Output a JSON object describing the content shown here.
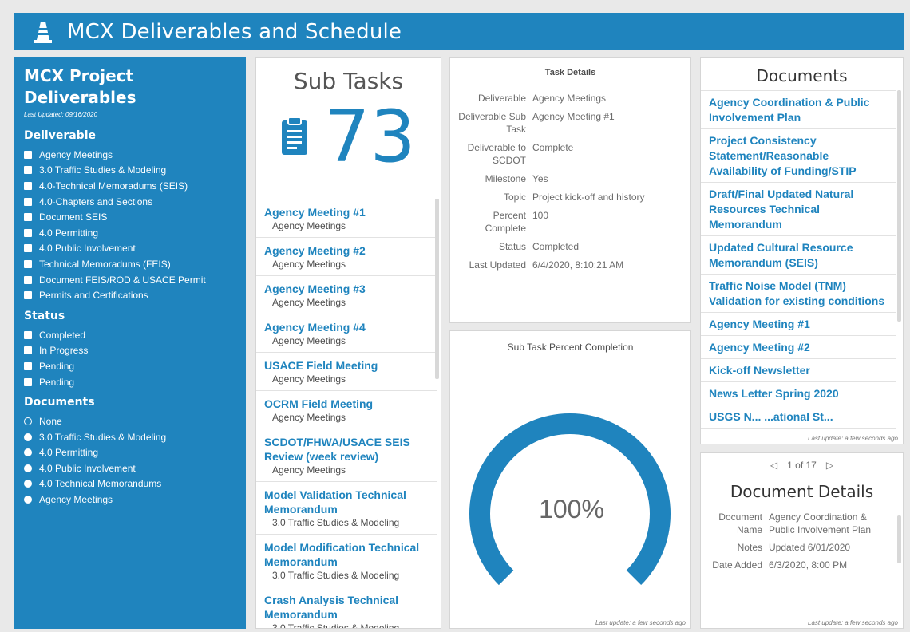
{
  "header": {
    "title": "MCX Deliverables and Schedule"
  },
  "sidebar": {
    "title": "MCX Project Deliverables",
    "last_updated": "Last Updated: 09/16/2020",
    "deliverable_heading": "Deliverable",
    "deliverables": [
      "Agency Meetings",
      "3.0 Traffic Studies & Modeling",
      "4.0-Technical Memoradums (SEIS)",
      "4.0-Chapters and Sections",
      "Document SEIS",
      "4.0 Permitting",
      "4.0 Public Involvement",
      "Technical Memoradums (FEIS)",
      "Document FEIS/ROD & USACE Permit",
      "Permits and Certifications"
    ],
    "status_heading": "Status",
    "statuses": [
      "Completed",
      "In Progress",
      "Pending",
      "Pending"
    ],
    "documents_heading": "Documents",
    "documents": [
      "None",
      "3.0 Traffic Studies & Modeling",
      "4.0 Permitting",
      "4.0 Public Involvement",
      "4.0 Technical Memorandums",
      "Agency Meetings"
    ]
  },
  "subtasks": {
    "title": "Sub Tasks",
    "count": "73",
    "icon": "clipboard-icon",
    "items": [
      {
        "name": "Agency Meeting #1",
        "category": "Agency Meetings"
      },
      {
        "name": "Agency Meeting #2",
        "category": "Agency Meetings"
      },
      {
        "name": "Agency Meeting #3",
        "category": "Agency Meetings"
      },
      {
        "name": "Agency Meeting #4",
        "category": "Agency Meetings"
      },
      {
        "name": "USACE Field Meeting",
        "category": "Agency Meetings"
      },
      {
        "name": "OCRM Field Meeting",
        "category": "Agency Meetings"
      },
      {
        "name": "SCDOT/FHWA/USACE SEIS Review (week review)",
        "category": "Agency Meetings"
      },
      {
        "name": "Model Validation Technical Memorandum",
        "category": "3.0 Traffic Studies & Modeling"
      },
      {
        "name": "Model Modification Technical Memorandum",
        "category": "3.0 Traffic Studies & Modeling"
      },
      {
        "name": "Crash Analysis Technical Memorandum",
        "category": "3.0 Traffic Studies & Modeling"
      }
    ]
  },
  "task_details": {
    "title": "Task Details",
    "rows": [
      {
        "label": "Deliverable",
        "value": "Agency Meetings"
      },
      {
        "label": "Deliverable Sub Task",
        "value": "Agency Meeting #1"
      },
      {
        "label": "Deliverable to SCDOT",
        "value": "Complete"
      },
      {
        "label": "Milestone",
        "value": "Yes"
      },
      {
        "label": "Topic",
        "value": "Project kick-off and history"
      },
      {
        "label": "Percent Complete",
        "value": "100"
      },
      {
        "label": "Status",
        "value": "Completed"
      },
      {
        "label": "Last Updated",
        "value": "6/4/2020, 8:10:21 AM"
      }
    ]
  },
  "gauge": {
    "title": "Sub Task Percent Completion",
    "percent": 100,
    "label": "100%",
    "updated": "Last update: a few seconds ago",
    "color": "#1f84be"
  },
  "documents": {
    "title": "Documents",
    "items": [
      "Agency Coordination & Public Involvement Plan",
      "Project Consistency Statement/Reasonable Availability of Funding/STIP",
      "Draft/Final Updated Natural Resources Technical Memorandum",
      "Updated Cultural Resource Memorandum (SEIS)",
      "Traffic Noise Model (TNM) Validation for existing conditions",
      "Agency Meeting #1",
      "Agency Meeting #2",
      "Kick-off Newsletter",
      "News Letter Spring 2020",
      "USGS N... ...ational St..."
    ],
    "updated": "Last update: a few seconds ago"
  },
  "document_details": {
    "pager": "1 of 17",
    "title": "Document Details",
    "rows": [
      {
        "label": "Document Name",
        "value": "Agency Coordination & Public Involvement Plan"
      },
      {
        "label": "Notes",
        "value": "Updated 6/01/2020"
      },
      {
        "label": "Date Added",
        "value": "6/3/2020, 8:00 PM"
      }
    ],
    "updated": "Last update: a few seconds ago"
  },
  "colors": {
    "accent": "#1f84be",
    "panel_bg": "#ffffff",
    "page_bg": "#e9e9e9"
  }
}
